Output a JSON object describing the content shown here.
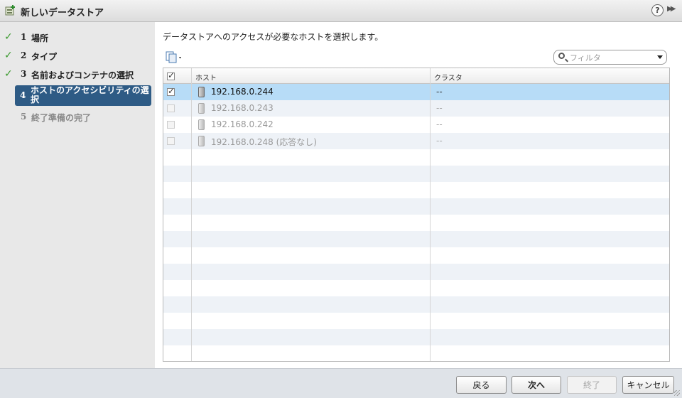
{
  "dialog": {
    "title": "新しいデータストア",
    "help_icon": "help-icon",
    "help_glyph": "?",
    "expand_icon": "expand-icon",
    "expand_glyph": "▶▶"
  },
  "steps": [
    {
      "num": "1",
      "label": "場所",
      "state": "done"
    },
    {
      "num": "2",
      "label": "タイプ",
      "state": "done"
    },
    {
      "num": "3",
      "label": "名前およびコンテナの選択",
      "state": "done"
    },
    {
      "num": "4",
      "label": "ホストのアクセシビリティの選択",
      "state": "active"
    },
    {
      "num": "5",
      "label": "終了準備の完了",
      "state": "todo"
    }
  ],
  "check_glyph": "✓",
  "main": {
    "instruction": "データストアへのアクセスが必要なホストを選択します。",
    "filter_placeholder": "フィルタ",
    "columns": {
      "host": "ホスト",
      "cluster": "クラスタ"
    },
    "rows": [
      {
        "host": "192.168.0.244",
        "cluster": "--",
        "checked": true,
        "enabled": true,
        "selected": true
      },
      {
        "host": "192.168.0.243",
        "cluster": "--",
        "checked": false,
        "enabled": false,
        "selected": false
      },
      {
        "host": "192.168.0.242",
        "cluster": "--",
        "checked": false,
        "enabled": false,
        "selected": false
      },
      {
        "host": "192.168.0.248 (応答なし)",
        "cluster": "--",
        "checked": false,
        "enabled": false,
        "selected": false
      }
    ]
  },
  "footer": {
    "back": "戻る",
    "next": "次へ",
    "finish": "終了",
    "cancel": "キャンセル"
  },
  "colors": {
    "active_step": "#2e5b85",
    "selected_row": "#b7dcf7",
    "check_green": "#3b9a2e"
  }
}
